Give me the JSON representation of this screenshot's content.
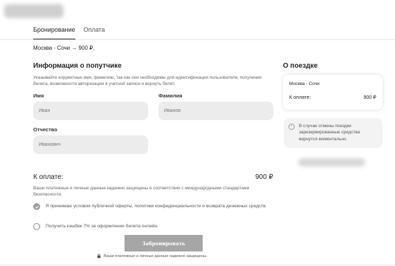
{
  "tabs": [
    {
      "label": "Бронирование",
      "active": true
    },
    {
      "label": "Оплата",
      "active": false
    }
  ],
  "route_summary": "Москва - Сочи → 900 ₽.",
  "passenger": {
    "title": "Информация о попутчике",
    "hint": "Указывайте корректные имя, фамилию, так как они необходимы для идентификации пользователя, получения билета, возможности авторизации в учетной записи и вернуть билет.",
    "first_name": {
      "label": "Имя",
      "value": "Иван"
    },
    "last_name": {
      "label": "Фамилия",
      "value": "Иванов"
    },
    "patronymic": {
      "label": "Отчество",
      "value": "Иванович"
    }
  },
  "payment": {
    "label": "К оплате:",
    "amount": "900 ₽",
    "secure_note": "Ваши платежные и личные данные надежно защищены в соответствии с международными стандартами безопасности.",
    "agree_terms": {
      "label": "Я принимаю условия публичной оферты, политики конфиденциальности и возврата денежных средств.",
      "checked": true
    },
    "cashback": {
      "label": "Получить кэшбек 7% за оформление билета онлайн.",
      "checked": false
    },
    "book_button": "Забронировать",
    "lock_note": "Ваши платежные и личные данные надежно защищены."
  },
  "trip": {
    "title": "О поездке",
    "route": "Москва - Сочи",
    "pay_label": "К оплате:",
    "pay_amount": "900 ₽",
    "info_text": "В случае отмены поездки зарезервированные средства вернутся моментально."
  },
  "colors": {
    "field_bg": "#ececec",
    "button_bg": "#a6a6a6",
    "checked": "#9e9e9e"
  },
  "icons": [
    "info-icon",
    "check-icon",
    "lock-icon"
  ]
}
